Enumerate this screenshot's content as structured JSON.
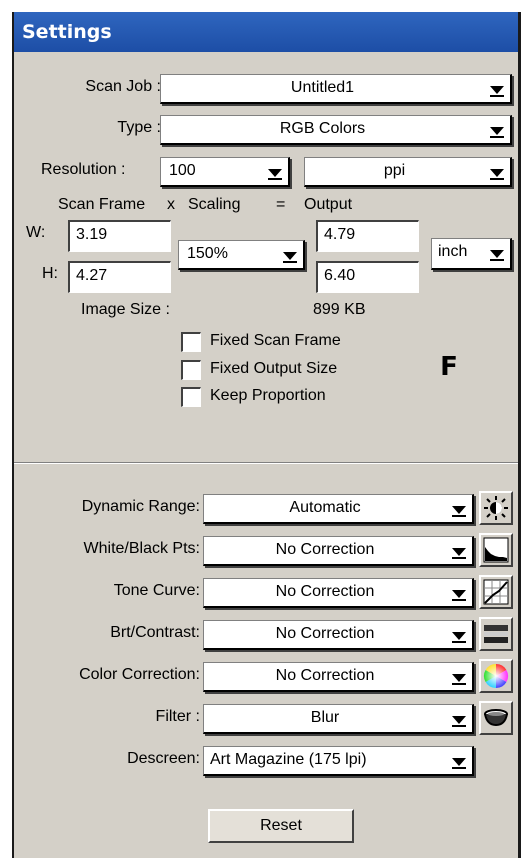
{
  "window": {
    "title": "Settings"
  },
  "scan_job": {
    "label": "Scan Job :",
    "value": "Untitled1"
  },
  "type": {
    "label": "Type :",
    "value": "RGB Colors"
  },
  "resolution": {
    "label": "Resolution :",
    "value": "100",
    "unit": "ppi"
  },
  "frame_header": {
    "scan_frame": "Scan Frame",
    "x": "x",
    "scaling": "Scaling",
    "eq": "=",
    "output": "Output"
  },
  "width": {
    "label": "W:",
    "scan": "3.19",
    "output": "4.79"
  },
  "height": {
    "label": "H:",
    "scan": "4.27",
    "output": "6.40"
  },
  "scaling": {
    "value": "150%"
  },
  "units": {
    "value": "inch"
  },
  "image_size": {
    "label": "Image Size :",
    "value": "899 KB"
  },
  "checkboxes": {
    "fixed_scan_frame": "Fixed Scan Frame",
    "fixed_output_size": "Fixed Output Size",
    "keep_proportion": "Keep Proportion"
  },
  "f_button": {
    "label": "F"
  },
  "adjustments": {
    "dynamic_range": {
      "label": "Dynamic Range:",
      "value": "Automatic"
    },
    "white_black": {
      "label": "White/Black Pts:",
      "value": "No Correction"
    },
    "tone_curve": {
      "label": "Tone Curve:",
      "value": "No Correction"
    },
    "brt_contrast": {
      "label": "Brt/Contrast:",
      "value": "No Correction"
    },
    "color_correction": {
      "label": "Color Correction:",
      "value": "No Correction"
    },
    "filter": {
      "label": "Filter :",
      "value": "Blur"
    },
    "descreen": {
      "label": "Descreen:",
      "value": "Art Magazine (175 lpi)"
    }
  },
  "reset_button": {
    "label": "Reset"
  },
  "icons": {
    "dynamic_range": "brightness-sun-icon",
    "white_black": "histogram-icon",
    "tone_curve": "tone-curve-icon",
    "brt_contrast": "contrast-bar-icon",
    "color_correction": "color-wheel-icon",
    "filter": "filter-bowl-icon"
  }
}
